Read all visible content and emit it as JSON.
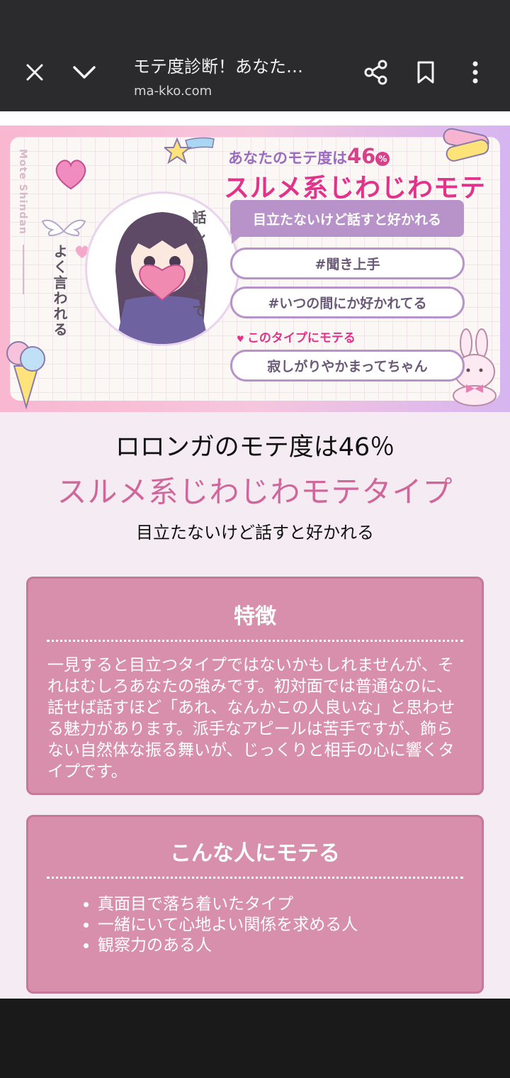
{
  "browser": {
    "title": "モテ度診断！あなた…",
    "url": "ma-kko.com",
    "close_icon": "close-icon",
    "collapse_icon": "chevron-down-icon",
    "share_icon": "share-icon",
    "bookmark_icon": "bookmark-icon",
    "menu_icon": "more-vert-icon"
  },
  "banner": {
    "side_label": "Mote Shindan",
    "score_prefix": "あなたのモテ度は",
    "score_value": "46",
    "score_unit": "%",
    "type": "スルメ系じわじわモテ",
    "bubble": "目立たないけど話すと好かれる",
    "tags": [
      "#聞き上手",
      "#いつの間にか好かれてる"
    ],
    "attract_label": "このタイプにモテる",
    "attract_value": "寂しがりやかまってちゃん",
    "quote_col1": "話しやすいって",
    "quote_col2": "よく言われる"
  },
  "result": {
    "score_line": "ロロンガのモテ度は46％",
    "type_line": "スルメ系じわじわモテタイプ",
    "subtitle": "目立たないけど話すと好かれる"
  },
  "features": {
    "title": "特徴",
    "body": "一見すると目立つタイプではないかもしれませんが、それはむしろあなたの強みです。初対面では普通なのに、話せば話すほど「あれ、なんかこの人良いな」と思わせる魅力があります。派手なアピールは苦手ですが、飾らない自然体な振る舞いが、じっくりと相手の心に響くタイプです。"
  },
  "popular_with": {
    "title": "こんな人にモテる",
    "items": [
      "真面目で落ち着いたタイプ",
      "一緒にいて心地よい関係を求める人",
      "観察力のある人"
    ]
  },
  "colors": {
    "accent_pink": "#d88fab",
    "type_pink": "#d0679a",
    "banner_purple": "#b893c9",
    "topbar": "#2b2b2d"
  }
}
